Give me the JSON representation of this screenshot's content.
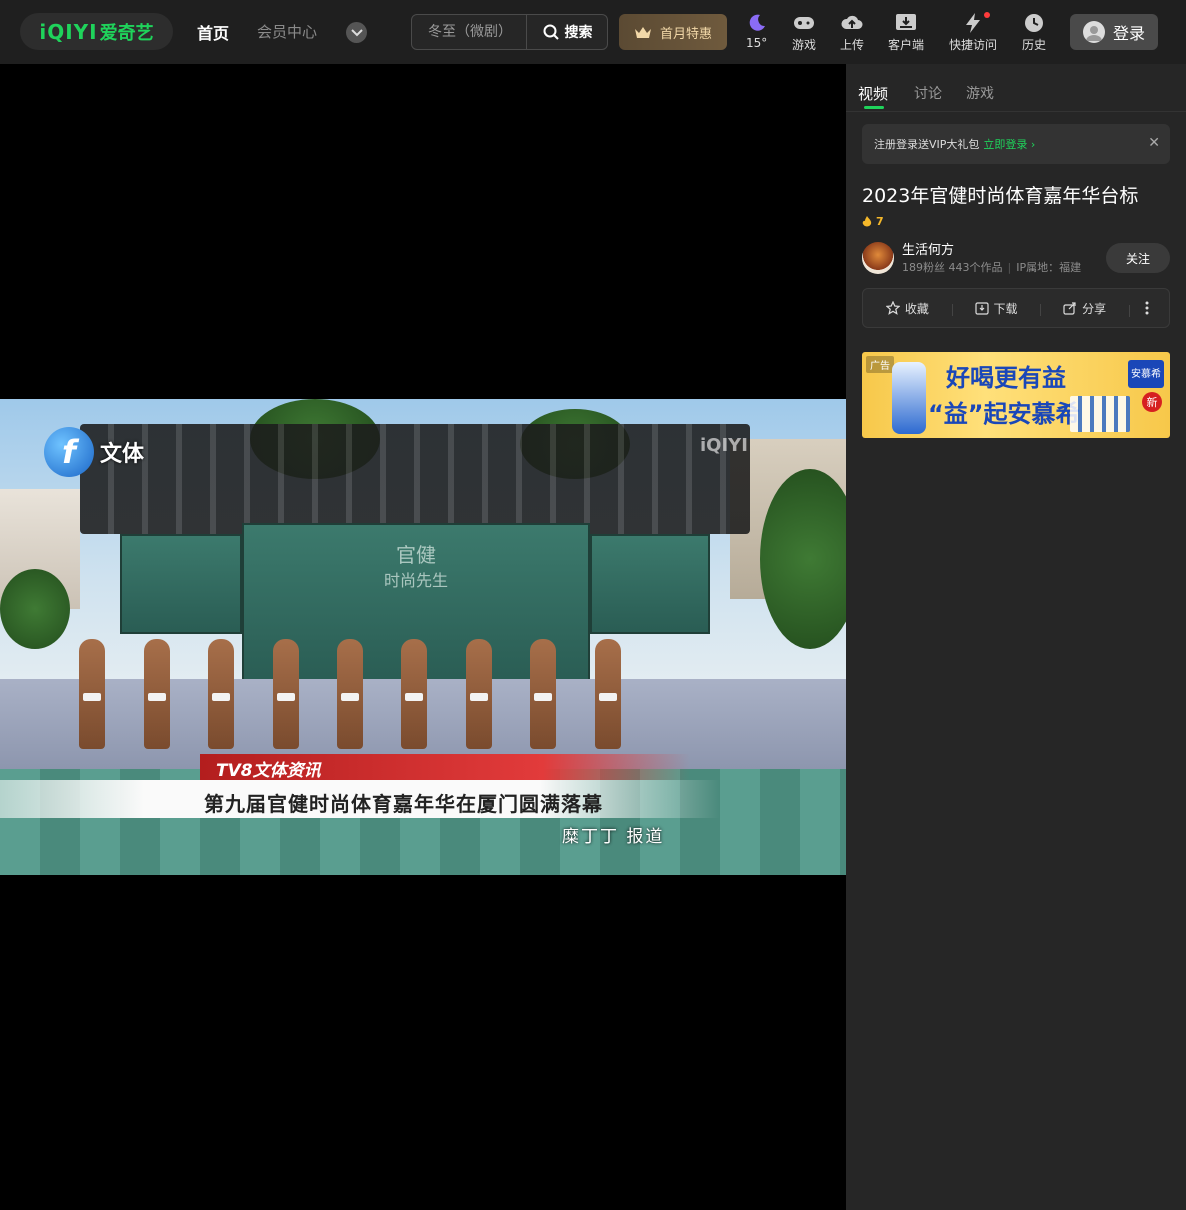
{
  "header": {
    "logo_text": "iQIYI",
    "logo_cn": "爱奇艺",
    "nav_home": "首页",
    "nav_vip": "会员中心",
    "search": {
      "placeholder": "冬至（微剧）",
      "button_label": "搜索"
    },
    "promo_label": "首月特惠",
    "tools": [
      {
        "label": "15°",
        "icon": "moon-icon"
      },
      {
        "label": "游戏",
        "icon": "gamepad-icon"
      },
      {
        "label": "上传",
        "icon": "upload-icon"
      },
      {
        "label": "客户端",
        "icon": "download-icon"
      },
      {
        "label": "快捷访问",
        "icon": "lightning-icon"
      },
      {
        "label": "历史",
        "icon": "clock-icon"
      }
    ],
    "login_label": "登录"
  },
  "video": {
    "brand_text": "文体",
    "watermark": "iQIYI",
    "screen_text_1": "官健",
    "screen_text_2": "时尚先生",
    "lower_third_program": "TV8文体资讯",
    "lower_third_headline": "第九届官健时尚体育嘉年华在厦门圆满落幕",
    "reporter": "糜丁丁  报道"
  },
  "panel": {
    "tabs": [
      "视频",
      "讨论",
      "游戏"
    ],
    "notice_text": "注册登录送VIP大礼包",
    "notice_link": "立即登录 ›",
    "title": "2023年官健时尚体育嘉年华台标",
    "heat": "7",
    "uploader": {
      "name": "生活何方",
      "fans": "189粉丝",
      "works": "443个作品",
      "ip": "IP属地：福建"
    },
    "follow_label": "关注",
    "actions": [
      "收藏",
      "下载",
      "分享"
    ],
    "ad": {
      "tag": "广告",
      "line1": "好喝更有益",
      "line2": "“益”起安慕希",
      "brand": "安慕希",
      "badge": "新"
    }
  },
  "colors": {
    "accent_green": "#1fd35b",
    "header_bg": "#1f1f1f",
    "panel_bg": "#262626"
  }
}
